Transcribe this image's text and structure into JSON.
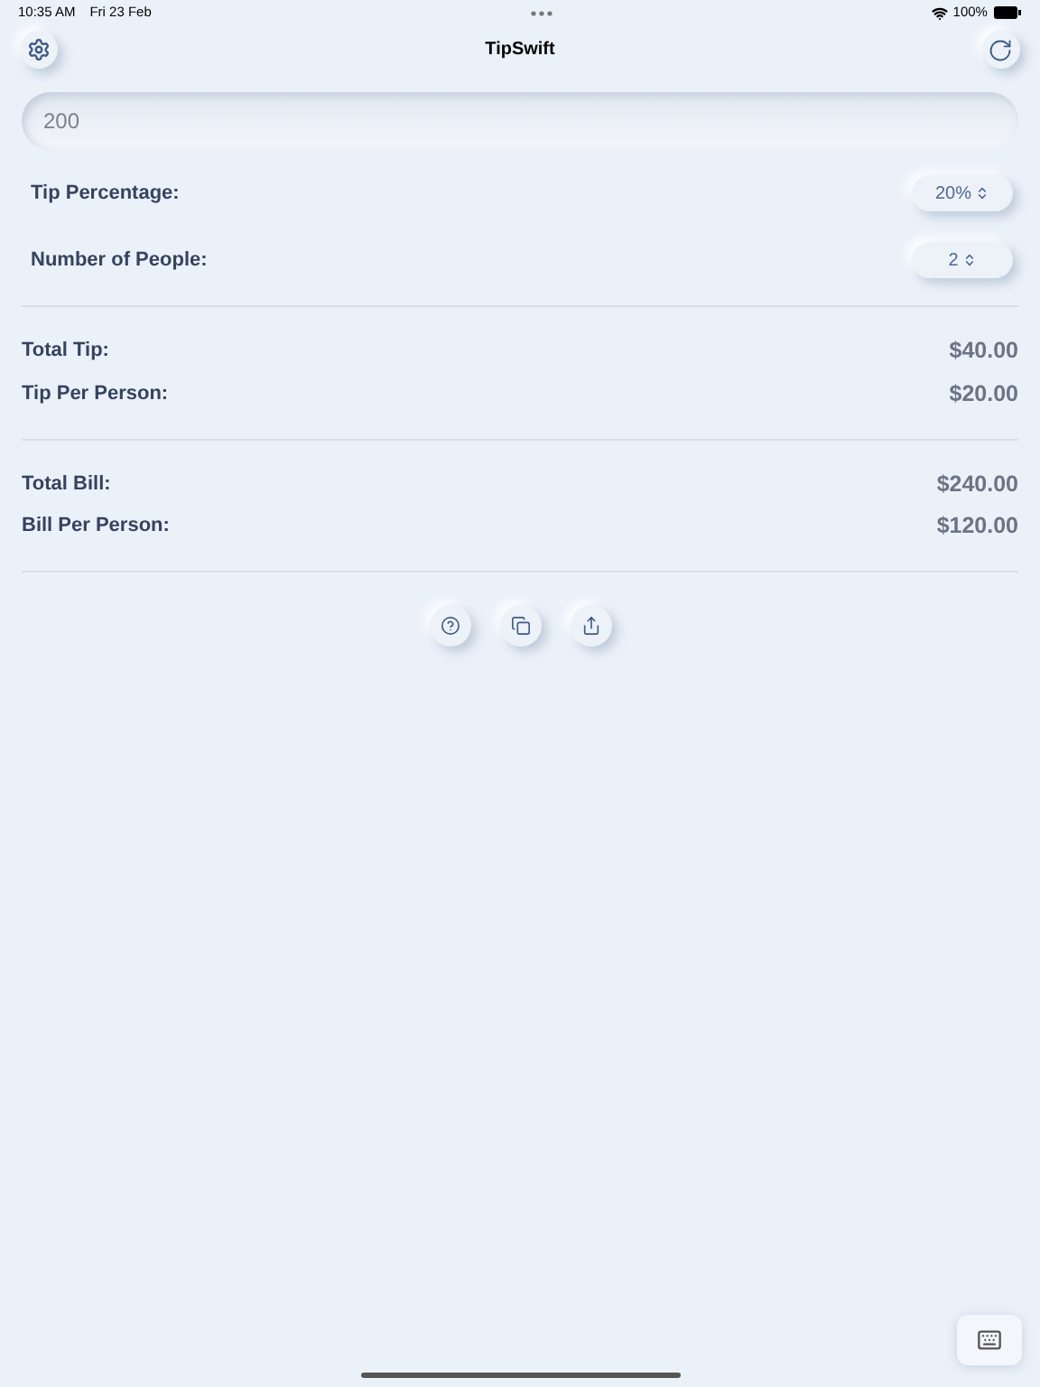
{
  "status_bar": {
    "time": "10:35 AM",
    "date": "Fri 23 Feb",
    "battery": "100%"
  },
  "nav": {
    "title": "TipSwift"
  },
  "bill_input": {
    "value": "200"
  },
  "settings": [
    {
      "label": "Tip Percentage:",
      "value": "20%"
    },
    {
      "label": "Number of People:",
      "value": "2"
    }
  ],
  "tip_results": [
    {
      "label": "Total Tip:",
      "value": "$40.00"
    },
    {
      "label": "Tip Per Person:",
      "value": "$20.00"
    }
  ],
  "bill_results": [
    {
      "label": "Total Bill:",
      "value": "$240.00"
    },
    {
      "label": "Bill Per Person:",
      "value": "$120.00"
    }
  ],
  "actions": [
    {
      "kind": "help"
    },
    {
      "kind": "copy"
    },
    {
      "kind": "share"
    }
  ]
}
